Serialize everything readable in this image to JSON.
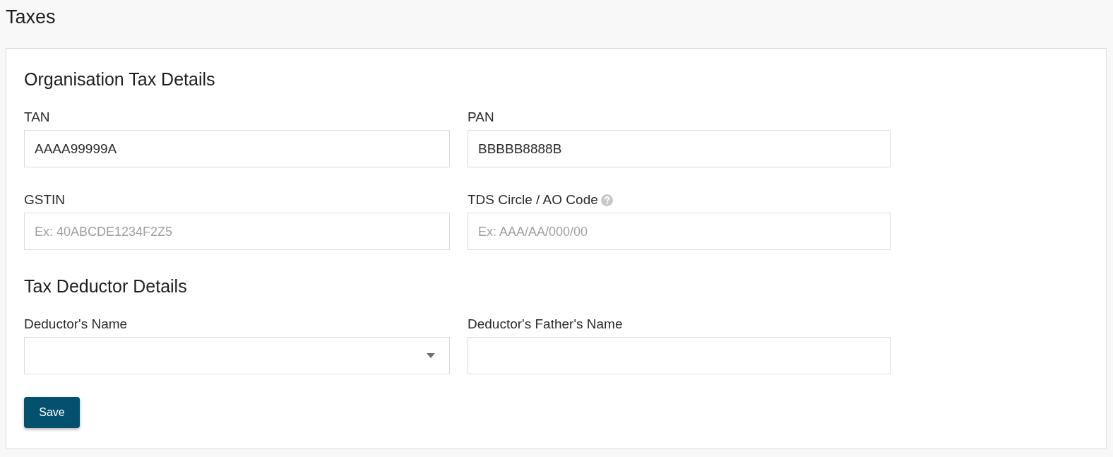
{
  "page": {
    "title": "Taxes"
  },
  "sections": [
    {
      "heading": "Organisation Tax Details",
      "fields": [
        {
          "label": "TAN",
          "kind": "text",
          "help": false,
          "value": "AAAA99999A"
        },
        {
          "label": "PAN",
          "kind": "text",
          "help": false,
          "value": "BBBBB8888B"
        },
        {
          "label": "GSTIN",
          "kind": "text",
          "help": false,
          "placeholder": "Ex: 40ABCDE1234F2Z5"
        },
        {
          "label": "TDS Circle / AO Code",
          "kind": "text",
          "help": true,
          "placeholder": "Ex: AAA/AA/000/00"
        }
      ]
    },
    {
      "heading": "Tax Deductor Details",
      "fields": [
        {
          "label": "Deductor's Name",
          "kind": "select",
          "help": false
        },
        {
          "label": "Deductor's Father's Name",
          "kind": "text",
          "help": false
        }
      ]
    }
  ],
  "save_button": {
    "label": "Save"
  }
}
